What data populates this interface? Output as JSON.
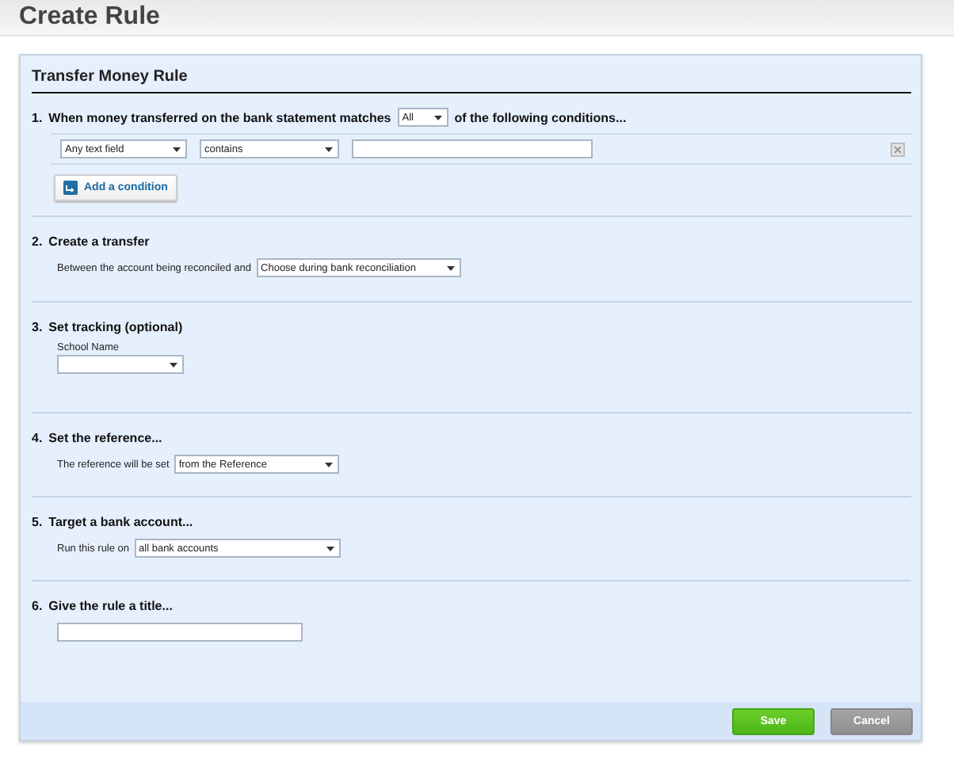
{
  "page_title": "Create Rule",
  "panel_title": "Transfer Money Rule",
  "sections": [
    {
      "kind": "match",
      "number": "1.",
      "heading_before": "When money transferred on the bank statement matches",
      "match_value": "All",
      "heading_after": "of the following conditions...",
      "condition": {
        "field": "Any text field",
        "operator": "contains"
      },
      "add_button": "Add a condition"
    },
    {
      "kind": "inline_select",
      "number": "2.",
      "heading": "Create a transfer",
      "label": "Between the account being reconciled and",
      "value": "Choose during bank reconciliation"
    },
    {
      "kind": "stacked_select",
      "number": "3.",
      "heading": "Set tracking (optional)",
      "label": "School Name"
    },
    {
      "kind": "inline_select",
      "number": "4.",
      "heading": "Set the reference...",
      "label": "The reference will be set",
      "value": "from the Reference"
    },
    {
      "kind": "inline_select",
      "number": "5.",
      "heading": "Target a bank account...",
      "label": "Run this rule on",
      "value": "all bank accounts"
    },
    {
      "kind": "text_input",
      "number": "6.",
      "heading": "Give the rule a title..."
    }
  ],
  "buttons": [
    {
      "kind": "primary",
      "label": "Save"
    },
    {
      "kind": "secondary",
      "label": "Cancel"
    }
  ]
}
